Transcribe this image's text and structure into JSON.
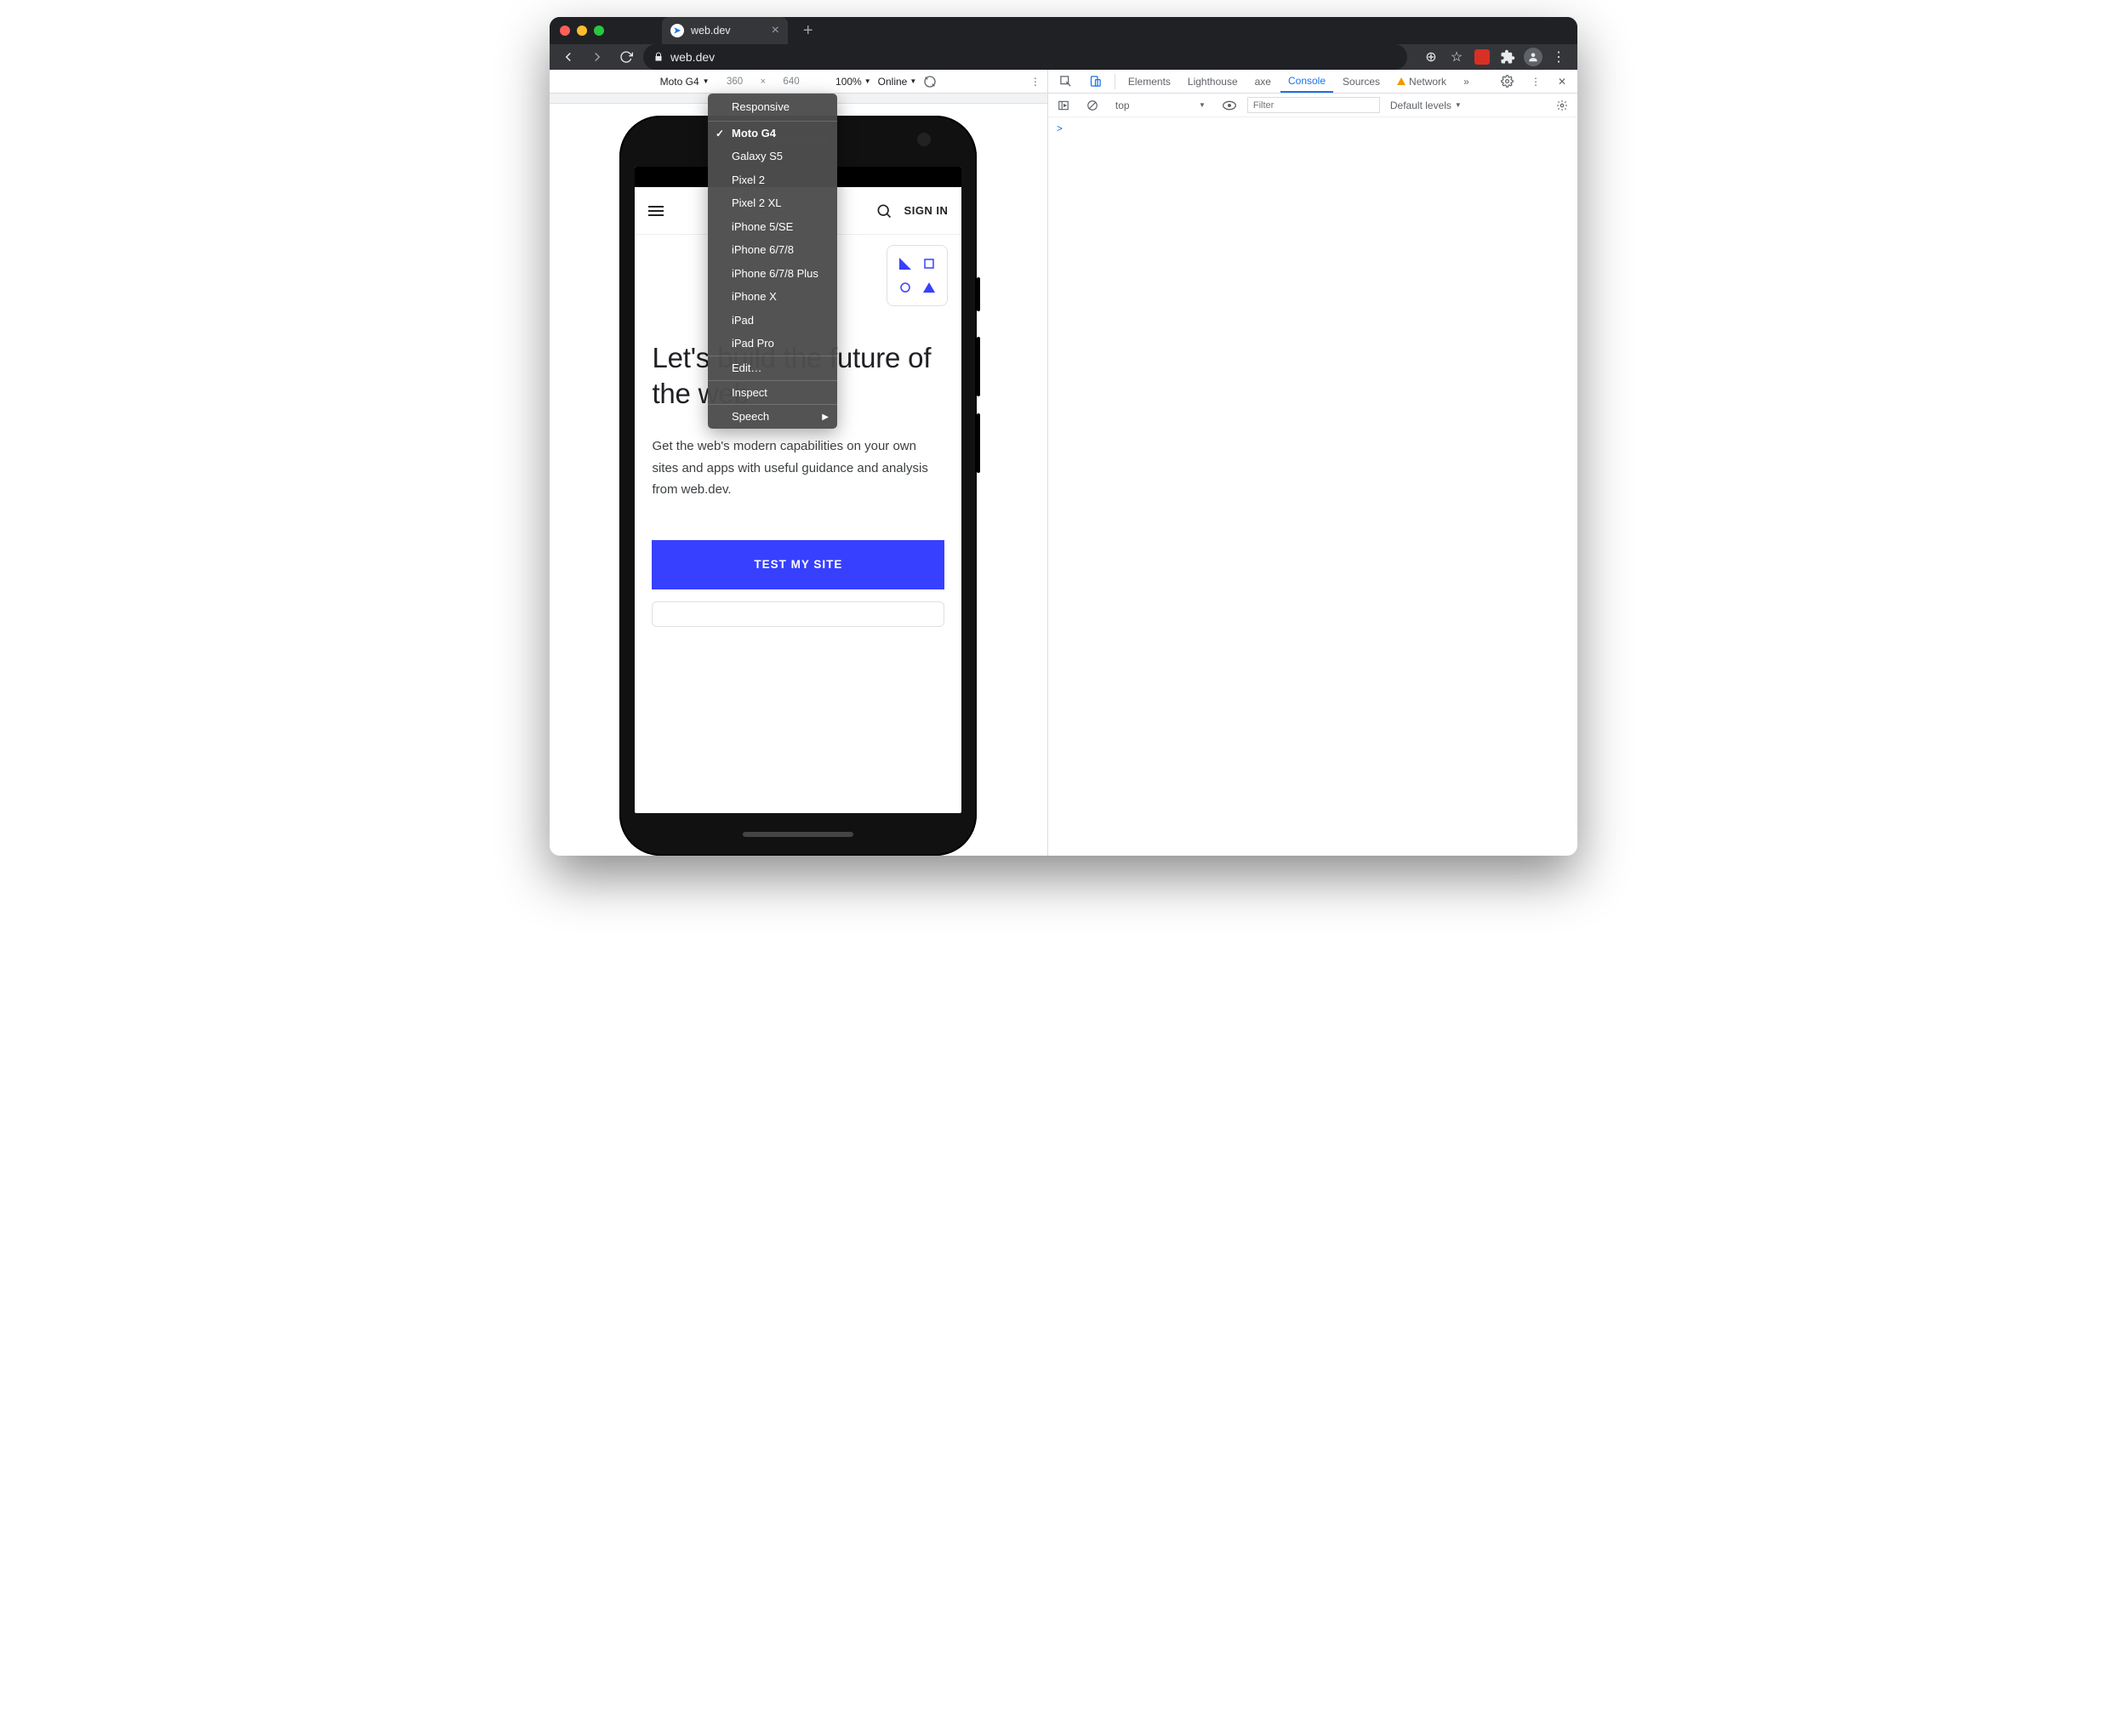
{
  "browser": {
    "tab_title": "web.dev",
    "url": "web.dev"
  },
  "device_toolbar": {
    "device": "Moto G4",
    "width": "360",
    "height": "640",
    "zoom": "100%",
    "throttle": "Online"
  },
  "device_menu": {
    "responsive": "Responsive",
    "devices": [
      "Moto G4",
      "Galaxy S5",
      "Pixel 2",
      "Pixel 2 XL",
      "iPhone 5/SE",
      "iPhone 6/7/8",
      "iPhone 6/7/8 Plus",
      "iPhone X",
      "iPad",
      "iPad Pro"
    ],
    "selected": "Moto G4",
    "edit": "Edit…",
    "inspect": "Inspect",
    "speech": "Speech"
  },
  "page": {
    "signin": "SIGN IN",
    "heading": "Let's build the future of the web",
    "body": "Get the web's modern capabilities on your own sites and apps with useful guidance and analysis from web.dev.",
    "cta": "TEST MY SITE"
  },
  "devtools": {
    "tabs": {
      "elements": "Elements",
      "lighthouse": "Lighthouse",
      "axe": "axe",
      "console": "Console",
      "sources": "Sources",
      "network": "Network",
      "more": "»"
    },
    "context": "top",
    "filter_placeholder": "Filter",
    "levels": "Default levels",
    "prompt": ">"
  }
}
